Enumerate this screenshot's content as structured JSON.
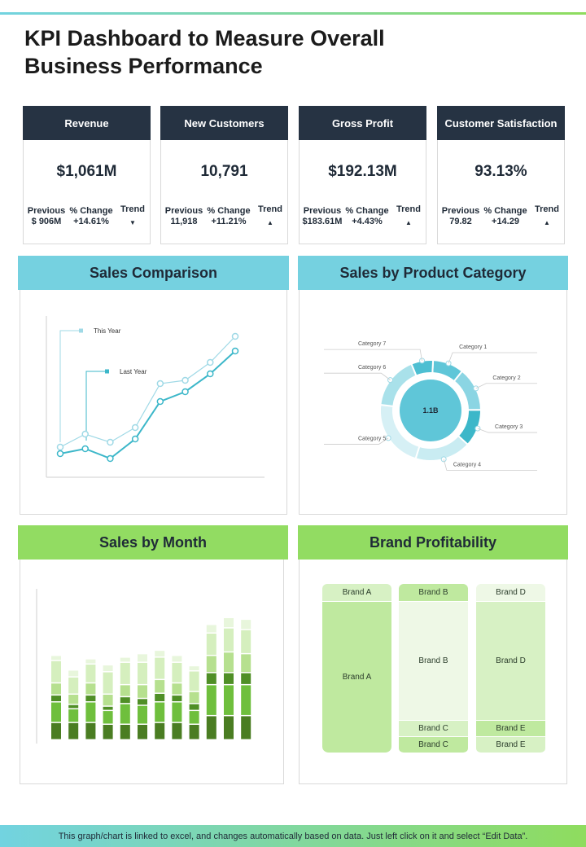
{
  "title": "KPI Dashboard to Measure Overall\nBusiness Performance",
  "kpis": [
    {
      "label": "Revenue",
      "value": "$1,061M",
      "prev_label": "Previous",
      "prev": "$ 906M",
      "chg_label": "% Change",
      "chg": "+14.61%",
      "trend_label": "Trend",
      "trend": "▼"
    },
    {
      "label": "New Customers",
      "value": "10,791",
      "prev_label": "Previous",
      "prev": "11,918",
      "chg_label": "% Change",
      "chg": "+11.21%",
      "trend_label": "Trend",
      "trend": "▲"
    },
    {
      "label": "Gross Profit",
      "value": "$192.13M",
      "prev_label": "Previous",
      "prev": "$183.61M",
      "chg_label": "% Change",
      "chg": "+4.43%",
      "trend_label": "Trend",
      "trend": "▲"
    },
    {
      "label": "Customer Satisfaction",
      "value": "93.13%",
      "prev_label": "Previous",
      "prev": "79.82",
      "chg_label": "% Change",
      "chg": "+14.29",
      "trend_label": "Trend",
      "trend": "▲"
    }
  ],
  "panels": {
    "sales_comparison": "Sales Comparison",
    "sales_by_category": "Sales by Product Category",
    "sales_by_month": "Sales by Month",
    "brand_profitability": "Brand Profitability"
  },
  "colors": {
    "dark": "#263343",
    "teal": "#75d1e0",
    "green": "#92dc62",
    "line_this": "#9fd9e6",
    "line_last": "#3cb7c9"
  },
  "chart_data": [
    {
      "type": "line",
      "series": [
        {
          "name": "This Year",
          "values": [
            6,
            14,
            9,
            18,
            45,
            47,
            58,
            74
          ]
        },
        {
          "name": "Last Year",
          "values": [
            2,
            5,
            -1,
            11,
            34,
            40,
            51,
            65
          ]
        }
      ],
      "ylim": [
        -10,
        85
      ]
    },
    {
      "type": "pie",
      "center_label": "1.1B",
      "categories": [
        "Category 1",
        "Category 2",
        "Category 3",
        "Category 4",
        "Category 5",
        "Category 6",
        "Category 7"
      ],
      "values": [
        10,
        14,
        12,
        18,
        22,
        17,
        7
      ]
    },
    {
      "type": "bar",
      "stacked": true,
      "series": [
        {
          "values": [
            20,
            20,
            20,
            18,
            18,
            18,
            20,
            20,
            18,
            28,
            28,
            28
          ]
        },
        {
          "values": [
            24,
            16,
            24,
            16,
            24,
            22,
            24,
            24,
            16,
            36,
            36,
            36
          ]
        },
        {
          "values": [
            8,
            5,
            8,
            5,
            8,
            8,
            10,
            8,
            8,
            14,
            14,
            14
          ]
        },
        {
          "values": [
            14,
            12,
            14,
            14,
            14,
            16,
            16,
            14,
            14,
            20,
            24,
            22
          ]
        },
        {
          "values": [
            26,
            20,
            22,
            26,
            26,
            26,
            26,
            24,
            24,
            26,
            28,
            28
          ]
        },
        {
          "values": [
            6,
            8,
            6,
            8,
            6,
            10,
            8,
            8,
            6,
            10,
            12,
            12
          ]
        }
      ]
    },
    {
      "type": "table",
      "columns": [
        {
          "header": "Brand A",
          "cells": [
            "Brand A"
          ]
        },
        {
          "header": "Brand B",
          "cells": [
            "Brand B",
            "Brand C",
            "Brand C"
          ]
        },
        {
          "header": "Brand D",
          "cells": [
            "Brand D",
            "Brand E",
            "Brand E"
          ]
        }
      ]
    }
  ],
  "footer": "This graph/chart is linked to excel,  and changes automatically based on data. Just left click on it and select “Edit Data”."
}
